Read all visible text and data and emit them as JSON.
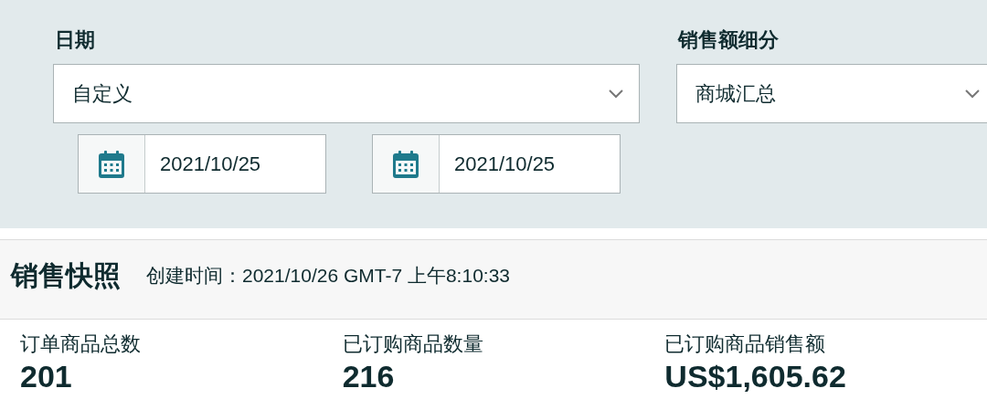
{
  "filters": {
    "date": {
      "label": "日期",
      "value": "自定义",
      "start_date": "2021/10/25",
      "end_date": "2021/10/25"
    },
    "sales_breakdown": {
      "label": "销售额细分",
      "value": "商城汇总"
    }
  },
  "snapshot": {
    "title": "销售快照",
    "created": "创建时间：2021/10/26 GMT-7 上午8:10:33",
    "metrics": [
      {
        "label": "订单商品总数",
        "value": "201"
      },
      {
        "label": "已订购商品数量",
        "value": "216"
      },
      {
        "label": "已订购商品销售额",
        "value": "US$1,605.62"
      }
    ]
  }
}
